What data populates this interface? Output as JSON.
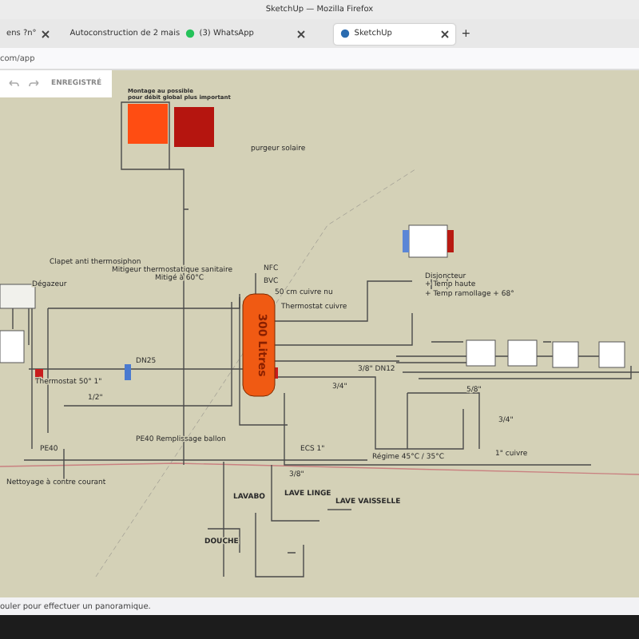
{
  "window": {
    "title": "SketchUp — Mozilla Firefox"
  },
  "tabs": [
    {
      "label": "ens ?n°",
      "selected": false,
      "kind": "plain"
    },
    {
      "label": "Autoconstruction de 2 mais",
      "selected": false,
      "kind": "page"
    },
    {
      "label": "(3) WhatsApp",
      "selected": false,
      "kind": "chat"
    },
    {
      "label": "SketchUp",
      "selected": true,
      "kind": "app"
    }
  ],
  "new_tab": "+",
  "address_bar": {
    "value": "com/app"
  },
  "toolbar": {
    "status": "ENREGISTRÉ"
  },
  "canvas": {
    "tank_label": "300 Litres",
    "labels": [
      "Montage au possible",
      "pour débit global plus important",
      "purgeur solaire",
      "Clapet anti thermosiphon",
      "Mitigeur thermostatique sanitaire",
      "Mitigé à 60°C",
      "Dégazeur",
      "NFC",
      "BVC",
      "50 cm cuivre nu",
      "Thermostat cuivre",
      "DN25",
      "Thermostat 50° 1\"",
      "1/2\"",
      "Disjoncteur",
      "+ Temp haute",
      "+ Temp ramollage + 68°",
      "3/8\" DN12",
      "3/4\"",
      "5/8\"",
      "3/4\"",
      "1\" cuivre",
      "Régime 45°C / 35°C",
      "PE40 Remplissage ballon",
      "PE40",
      "ECS 1\"",
      "3/8\"",
      "Nettoyage à contre courant",
      "LAVABO",
      "DOUCHE",
      "LAVE LINGE",
      "LAVE VAISSELLE"
    ]
  },
  "status_bar": "ouler pour effectuer un panoramique."
}
